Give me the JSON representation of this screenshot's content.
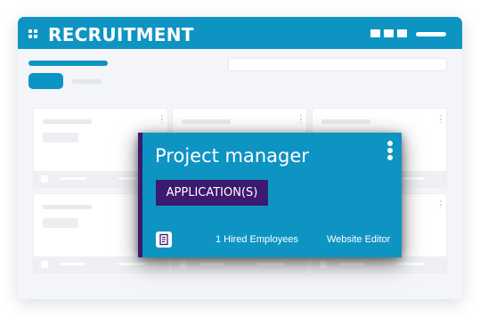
{
  "app": {
    "title": "RECRUITMENT"
  },
  "job_card": {
    "title": "Project manager",
    "applications_label": "APPLICATION(S)",
    "hired_text": "1 Hired Employees",
    "role_text": "Website Editor"
  },
  "icons": {
    "app_menu": "grid-icon",
    "more": "kebab-icon",
    "document": "document-icon"
  },
  "colors": {
    "primary": "#0e94c3",
    "accent": "#3b1a6f",
    "background": "#f4f5f8"
  }
}
